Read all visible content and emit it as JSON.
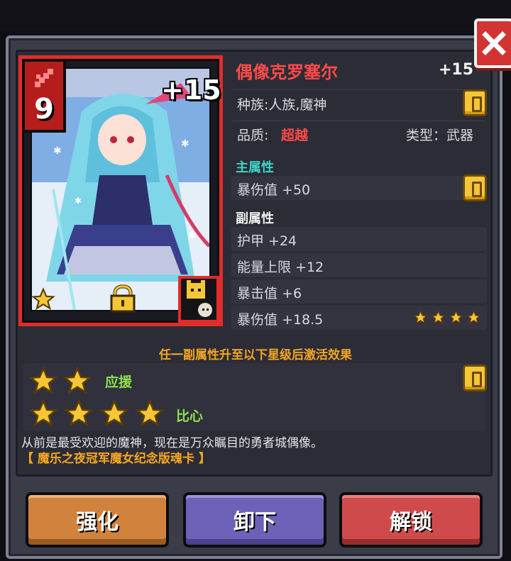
{
  "card": {
    "level": "9",
    "plus": "+15",
    "level_icon": "sword-icon",
    "lock_icon": "lock-icon",
    "pet_icon": "cat-pet-icon",
    "rarity_icon": "star-icon"
  },
  "info": {
    "name": "偶像克罗塞尔",
    "plus_level": "+15",
    "race": "种族:人族,魔神",
    "quality_label": "品质:",
    "quality_value": "超越",
    "type": "类型：武器"
  },
  "main_attr": {
    "title": "主属性",
    "items": [
      {
        "text": "暴伤值 +50"
      }
    ]
  },
  "sub_attr": {
    "title": "副属性",
    "items": [
      {
        "text": "护甲 +24"
      },
      {
        "text": "能量上限 +12"
      },
      {
        "text": "暴击值 +6"
      },
      {
        "text": "暴伤值 +18.5",
        "stars": 4
      }
    ]
  },
  "activation": {
    "hint": "任一副属性升至以下星级后激活效果",
    "tiers": [
      {
        "stars": 2,
        "label": "应援"
      },
      {
        "stars": 4,
        "label": "比心"
      }
    ]
  },
  "description": "从前是最受欢迎的魔神，现在是万众瞩目的勇者城偶像。",
  "source": "【 魔乐之夜冠军魔女纪念版魂卡 】",
  "buttons": {
    "upgrade": "强化",
    "unequip": "卸下",
    "unlock": "解锁"
  },
  "colors": {
    "name": "#ff4a4a",
    "quality": "#ff4a4a",
    "main_title": "#3fd3c6",
    "activation_text": "#f5a623",
    "tier_label": "#8ee04d",
    "star": "#f5c637"
  }
}
